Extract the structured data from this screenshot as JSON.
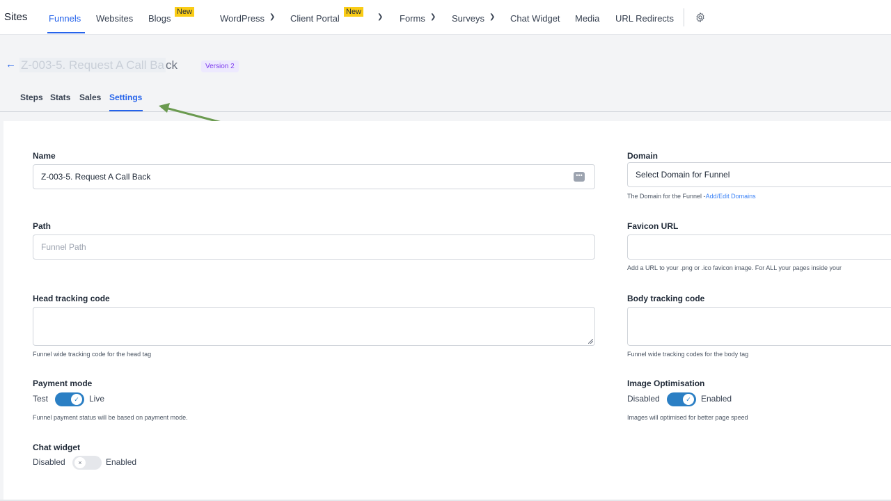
{
  "topnav": {
    "brand": "Sites",
    "items": [
      "Funnels",
      "Websites",
      "Blogs",
      "WordPress",
      "Client Portal",
      "Forms",
      "Surveys",
      "Chat Widget",
      "Media",
      "URL Redirects"
    ],
    "new_badge": "New"
  },
  "header": {
    "title_blurred": "Z-003-5. Request A Call Ba",
    "title_visible": "ck",
    "version": "Version 2",
    "tabs": [
      "Steps",
      "Stats",
      "Sales",
      "Settings"
    ]
  },
  "form": {
    "name": {
      "label": "Name",
      "value": "Z-003-5. Request A Call Back"
    },
    "path": {
      "label": "Path",
      "placeholder": "Funnel Path"
    },
    "head_tracking": {
      "label": "Head tracking code",
      "help": "Funnel wide tracking code for the head tag"
    },
    "payment": {
      "label": "Payment mode",
      "left": "Test",
      "right": "Live",
      "help": "Funnel payment status will be based on payment mode."
    },
    "chat": {
      "label": "Chat widget",
      "left": "Disabled",
      "right": "Enabled"
    },
    "domain": {
      "label": "Domain",
      "value": "Select Domain for Funnel",
      "help": "The Domain for the Funnel -",
      "help_link": "Add/Edit Domains"
    },
    "favicon": {
      "label": "Favicon URL",
      "help": "Add a URL to your .png or .ico favicon image. For ALL your pages inside your"
    },
    "body_tracking": {
      "label": "Body tracking code",
      "help": "Funnel wide tracking codes for the body tag"
    },
    "image_opt": {
      "label": "Image Optimisation",
      "left": "Disabled",
      "right": "Enabled",
      "help": "Images will optimised for better page speed"
    }
  },
  "colors": {
    "accent": "#2563eb",
    "toggle_on": "#2b7fc4",
    "annotation_arrow": "#6a9a4f",
    "new_badge": "#facc15"
  }
}
